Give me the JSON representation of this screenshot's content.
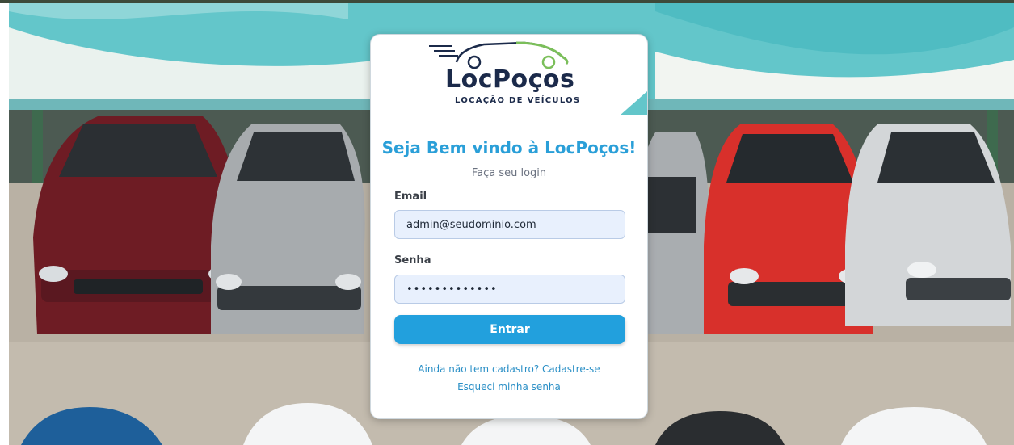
{
  "brand": {
    "name": "LocPoços",
    "tagline": "LOCAÇÃO DE VEÍCULOS",
    "colors": {
      "navy": "#1b2a4a",
      "accent": "#2a9fd8",
      "green": "#7bbf5a"
    }
  },
  "login": {
    "heading": "Seja Bem vindo à LocPoços!",
    "subheading": "Faça seu login",
    "email_label": "Email",
    "email_value": "admin@seudominio.com",
    "password_label": "Senha",
    "password_value": "•••••••••••••",
    "submit_label": "Entrar",
    "signup_link": "Ainda não tem cadastro? Cadastre-se",
    "forgot_link": "Esqueci minha senha"
  },
  "background": {
    "description_icon": "parking-lot-photo",
    "colors": {
      "roof": "#5cc4c9",
      "ground": "#b7afa2"
    }
  }
}
